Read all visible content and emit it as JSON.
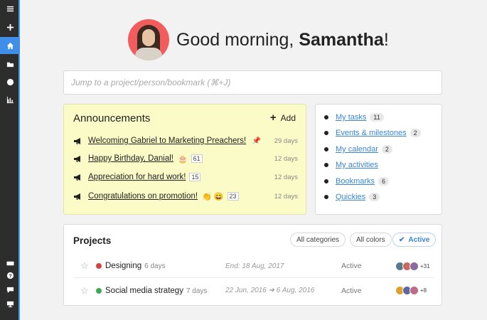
{
  "sidebar": {
    "top": [
      {
        "icon": "menu-icon",
        "glyph": "≡"
      },
      {
        "icon": "plus-icon",
        "glyph": "+"
      },
      {
        "icon": "home-icon",
        "glyph": ""
      },
      {
        "icon": "folder-icon",
        "glyph": ""
      },
      {
        "icon": "globe-icon",
        "glyph": ""
      },
      {
        "icon": "chart-icon",
        "glyph": ""
      }
    ],
    "bottom": [
      {
        "icon": "keyboard-icon"
      },
      {
        "icon": "help-icon",
        "glyph": "?"
      },
      {
        "icon": "chat-icon"
      },
      {
        "icon": "monitor-icon"
      }
    ]
  },
  "greeting": {
    "prefix": "Good morning, ",
    "name": "Samantha",
    "suffix": "!"
  },
  "search": {
    "placeholder": "Jump to a project/person/bookmark (⌘+J)"
  },
  "announcements": {
    "title": "Announcements",
    "add_label": "Add",
    "items": [
      {
        "title": "Welcoming Gabriel to Marketing Preachers!",
        "pinned": true,
        "pin_glyph": "📌",
        "days": "29 days"
      },
      {
        "title": "Happy Birthday, Danial!",
        "emoji": "🎂",
        "count": "61",
        "days": "12 days"
      },
      {
        "title": "Appreciation for hard work!",
        "count": "15",
        "days": "12 days"
      },
      {
        "title": "Congratulations on promotion!",
        "emoji": "👏 😄",
        "count": "23",
        "days": "12 days"
      }
    ]
  },
  "quick_links": [
    {
      "label": "My tasks",
      "count": "11"
    },
    {
      "label": "Events & milestones",
      "count": "2"
    },
    {
      "label": "My calendar",
      "count": "2"
    },
    {
      "label": "My activities",
      "count": ""
    },
    {
      "label": "Bookmarks",
      "count": "6"
    },
    {
      "label": "Quickies",
      "count": "3"
    }
  ],
  "projects": {
    "title": "Projects",
    "filters": [
      "All categories",
      "All colors",
      "Active"
    ],
    "active_check": "✔",
    "rows": [
      {
        "name": "Designing",
        "age": "6 days",
        "date": "End: 18 Aug, 2017",
        "status": "Active",
        "color": "#d24444",
        "more": "+31"
      },
      {
        "name": "Social media strategy",
        "age": "7 days",
        "date": "22 Jun, 2016 ➔ 6 Aug, 2016",
        "status": "Active",
        "color": "#3aaa55",
        "more": "+8"
      }
    ]
  },
  "colors": {
    "accent": "#3f8fe8",
    "announcement_bg": "#fbfbc8",
    "link": "#3a86d4"
  }
}
